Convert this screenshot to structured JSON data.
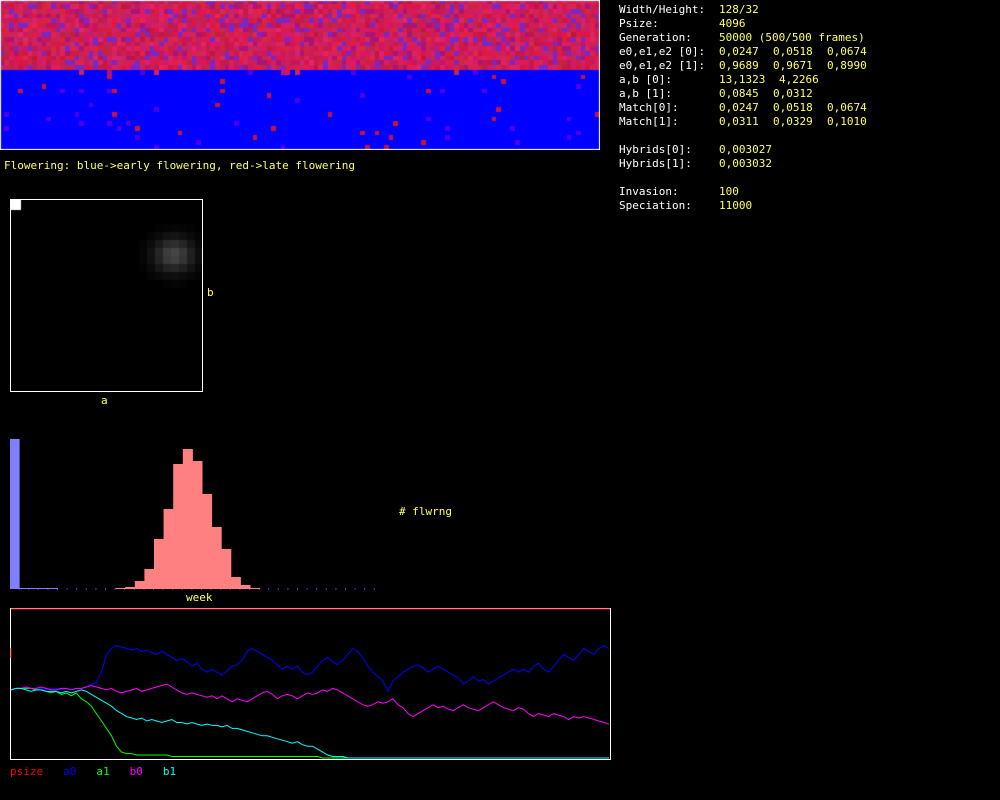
{
  "colors": {
    "blue": "#0000ff",
    "red": "#dd0033",
    "label": "#ffff66",
    "psize": "#ff0000",
    "a0": "#0000ff",
    "a1": "#00ff00",
    "b0": "#ff00ff",
    "b1": "#00ffff",
    "hist_blue": "#8080ff",
    "hist_red": "#ff8080"
  },
  "field": {
    "caption": "Flowering: blue->early flowering, red->late flowering",
    "red_fraction": 0.5
  },
  "ab_plot": {
    "xlabel": "a",
    "ylabel": "b"
  },
  "histogram": {
    "xlabel": "week",
    "ylabel": "# flwrng",
    "chart_data": {
      "type": "bar",
      "bins": 38,
      "blue_values": [
        150,
        1,
        1,
        1,
        1,
        0,
        0,
        0,
        0,
        0,
        0,
        0,
        0,
        0,
        0,
        0,
        0,
        0,
        0,
        0,
        0,
        0,
        0,
        0,
        0,
        0,
        0,
        0,
        0,
        0,
        0,
        0,
        0,
        0,
        0,
        0,
        0,
        0
      ],
      "red_values": [
        0,
        0,
        0,
        0,
        0,
        0,
        0,
        0,
        0,
        0,
        0,
        1,
        2,
        8,
        20,
        50,
        80,
        125,
        140,
        128,
        95,
        62,
        40,
        12,
        4,
        1,
        0,
        0,
        0,
        0,
        0,
        0,
        0,
        0,
        0,
        0,
        0,
        0
      ],
      "ymax": 150
    }
  },
  "trend": {
    "legend": [
      {
        "key": "psize",
        "label": "psize"
      },
      {
        "key": "a0",
        "label": "a0"
      },
      {
        "key": "a1",
        "label": "a1"
      },
      {
        "key": "b0",
        "label": "b0"
      },
      {
        "key": "b1",
        "label": "b1"
      }
    ],
    "chart_data": {
      "type": "line",
      "x_points": 120,
      "series": [
        {
          "name": "a0",
          "values": [
            0.46,
            0.47,
            0.47,
            0.48,
            0.47,
            0.47,
            0.47,
            0.46,
            0.47,
            0.47,
            0.46,
            0.47,
            0.46,
            0.47,
            0.47,
            0.48,
            0.5,
            0.51,
            0.58,
            0.7,
            0.74,
            0.76,
            0.75,
            0.74,
            0.73,
            0.74,
            0.72,
            0.73,
            0.71,
            0.7,
            0.72,
            0.7,
            0.68,
            0.66,
            0.67,
            0.65,
            0.62,
            0.64,
            0.6,
            0.58,
            0.6,
            0.58,
            0.56,
            0.59,
            0.62,
            0.63,
            0.66,
            0.72,
            0.74,
            0.72,
            0.7,
            0.68,
            0.66,
            0.63,
            0.6,
            0.62,
            0.6,
            0.62,
            0.58,
            0.56,
            0.58,
            0.62,
            0.66,
            0.68,
            0.65,
            0.63,
            0.66,
            0.7,
            0.74,
            0.72,
            0.68,
            0.62,
            0.58,
            0.55,
            0.52,
            0.45,
            0.52,
            0.55,
            0.58,
            0.6,
            0.62,
            0.63,
            0.61,
            0.58,
            0.6,
            0.62,
            0.6,
            0.58,
            0.56,
            0.54,
            0.5,
            0.52,
            0.55,
            0.52,
            0.53,
            0.5,
            0.52,
            0.54,
            0.56,
            0.58,
            0.6,
            0.58,
            0.6,
            0.58,
            0.62,
            0.64,
            0.6,
            0.58,
            0.62,
            0.66,
            0.7,
            0.68,
            0.66,
            0.7,
            0.74,
            0.72,
            0.7,
            0.74,
            0.76,
            0.74
          ]
        },
        {
          "name": "a1",
          "values": [
            0.46,
            0.47,
            0.47,
            0.47,
            0.47,
            0.46,
            0.46,
            0.45,
            0.44,
            0.45,
            0.43,
            0.44,
            0.42,
            0.44,
            0.4,
            0.38,
            0.35,
            0.3,
            0.25,
            0.2,
            0.15,
            0.08,
            0.04,
            0.03,
            0.03,
            0.02,
            0.02,
            0.02,
            0.02,
            0.02,
            0.02,
            0.02,
            0.01,
            0.01,
            0.01,
            0.01,
            0.01,
            0.01,
            0.01,
            0.01,
            0.01,
            0.01,
            0.01,
            0.01,
            0.01,
            0.01,
            0.01,
            0.01,
            0.01,
            0.01,
            0.01,
            0.01,
            0.01,
            0.01,
            0.01,
            0.01,
            0.01,
            0.01,
            0.01,
            0.01,
            0.01,
            0.01,
            0.0,
            0.0,
            0.0,
            0.0,
            0.0,
            0.0,
            0.0,
            0.0,
            0.0,
            0.0,
            0.0,
            0.0,
            0.0,
            0.0,
            0.0,
            0.0,
            0.0,
            0.0,
            0.0,
            0.0,
            0.0,
            0.0,
            0.0,
            0.0,
            0.0,
            0.0,
            0.0,
            0.0,
            0.0,
            0.0,
            0.0,
            0.0,
            0.0,
            0.0,
            0.0,
            0.0,
            0.0,
            0.0,
            0.0,
            0.0,
            0.0,
            0.0,
            0.0,
            0.0,
            0.0,
            0.0,
            0.0,
            0.0,
            0.0,
            0.0,
            0.0,
            0.0,
            0.0,
            0.0,
            0.0,
            0.0,
            0.0,
            0.0
          ]
        },
        {
          "name": "b0",
          "values": [
            0.46,
            0.47,
            0.47,
            0.48,
            0.47,
            0.47,
            0.48,
            0.47,
            0.46,
            0.46,
            0.47,
            0.47,
            0.46,
            0.47,
            0.47,
            0.48,
            0.49,
            0.48,
            0.47,
            0.46,
            0.47,
            0.45,
            0.44,
            0.45,
            0.46,
            0.47,
            0.45,
            0.46,
            0.47,
            0.48,
            0.49,
            0.5,
            0.48,
            0.46,
            0.44,
            0.43,
            0.44,
            0.43,
            0.42,
            0.41,
            0.42,
            0.4,
            0.42,
            0.4,
            0.38,
            0.4,
            0.39,
            0.38,
            0.4,
            0.42,
            0.44,
            0.45,
            0.43,
            0.4,
            0.42,
            0.43,
            0.42,
            0.4,
            0.42,
            0.44,
            0.43,
            0.44,
            0.46,
            0.45,
            0.47,
            0.46,
            0.44,
            0.42,
            0.4,
            0.38,
            0.36,
            0.35,
            0.36,
            0.38,
            0.37,
            0.38,
            0.4,
            0.36,
            0.34,
            0.3,
            0.28,
            0.3,
            0.32,
            0.34,
            0.36,
            0.34,
            0.35,
            0.33,
            0.32,
            0.34,
            0.36,
            0.34,
            0.33,
            0.32,
            0.34,
            0.36,
            0.38,
            0.36,
            0.34,
            0.33,
            0.32,
            0.34,
            0.33,
            0.3,
            0.28,
            0.3,
            0.29,
            0.28,
            0.3,
            0.29,
            0.28,
            0.26,
            0.28,
            0.27,
            0.28,
            0.27,
            0.26,
            0.25,
            0.24,
            0.23
          ]
        },
        {
          "name": "b1",
          "values": [
            0.46,
            0.47,
            0.47,
            0.46,
            0.45,
            0.46,
            0.46,
            0.45,
            0.45,
            0.45,
            0.44,
            0.45,
            0.44,
            0.45,
            0.46,
            0.45,
            0.43,
            0.41,
            0.39,
            0.37,
            0.35,
            0.32,
            0.3,
            0.28,
            0.27,
            0.26,
            0.27,
            0.25,
            0.26,
            0.25,
            0.24,
            0.25,
            0.26,
            0.24,
            0.24,
            0.23,
            0.24,
            0.23,
            0.22,
            0.23,
            0.22,
            0.22,
            0.21,
            0.22,
            0.2,
            0.2,
            0.19,
            0.18,
            0.17,
            0.16,
            0.15,
            0.15,
            0.14,
            0.13,
            0.12,
            0.11,
            0.1,
            0.11,
            0.09,
            0.08,
            0.08,
            0.06,
            0.04,
            0.02,
            0.01,
            0.01,
            0.01,
            0.0,
            0.0,
            0.0,
            0.0,
            0.0,
            0.0,
            0.0,
            0.0,
            0.0,
            0.0,
            0.0,
            0.0,
            0.0,
            0.0,
            0.0,
            0.0,
            0.0,
            0.0,
            0.0,
            0.0,
            0.0,
            0.0,
            0.0,
            0.0,
            0.0,
            0.0,
            0.0,
            0.0,
            0.0,
            0.0,
            0.0,
            0.0,
            0.0,
            0.0,
            0.0,
            0.0,
            0.0,
            0.0,
            0.0,
            0.0,
            0.0,
            0.0,
            0.0,
            0.0,
            0.0,
            0.0,
            0.0,
            0.0,
            0.0,
            0.0,
            0.0,
            0.0,
            0.0
          ]
        }
      ]
    }
  },
  "stats": [
    {
      "key": "Width/Height:",
      "values": [
        "128/32"
      ]
    },
    {
      "key": "Psize:",
      "values": [
        "4096"
      ]
    },
    {
      "key": "Generation:",
      "values": [
        "50000 (500/500 frames)"
      ]
    },
    {
      "key": "e0,e1,e2 [0]:",
      "values": [
        "0,0247",
        "0,0518",
        "0,0674"
      ]
    },
    {
      "key": "e0,e1,e2 [1]:",
      "values": [
        "0,9689",
        "0,9671",
        "0,8990"
      ]
    },
    {
      "key": "a,b [0]:",
      "values": [
        "13,1323",
        "4,2266"
      ]
    },
    {
      "key": "a,b [1]:",
      "values": [
        "0,0845",
        "0,0312"
      ]
    },
    {
      "key": "Match[0]:",
      "values": [
        "0,0247",
        "0,0518",
        "0,0674"
      ]
    },
    {
      "key": "Match[1]:",
      "values": [
        "0,0311",
        "0,0329",
        "0,1010"
      ]
    },
    {
      "key": "",
      "values": []
    },
    {
      "key": "Hybrids[0]:",
      "values": [
        "0,003027"
      ]
    },
    {
      "key": "Hybrids[1]:",
      "values": [
        "0,003032"
      ]
    },
    {
      "key": "",
      "values": []
    },
    {
      "key": "Invasion:",
      "values": [
        "100"
      ]
    },
    {
      "key": "Speciation:",
      "values": [
        "11000"
      ]
    }
  ]
}
